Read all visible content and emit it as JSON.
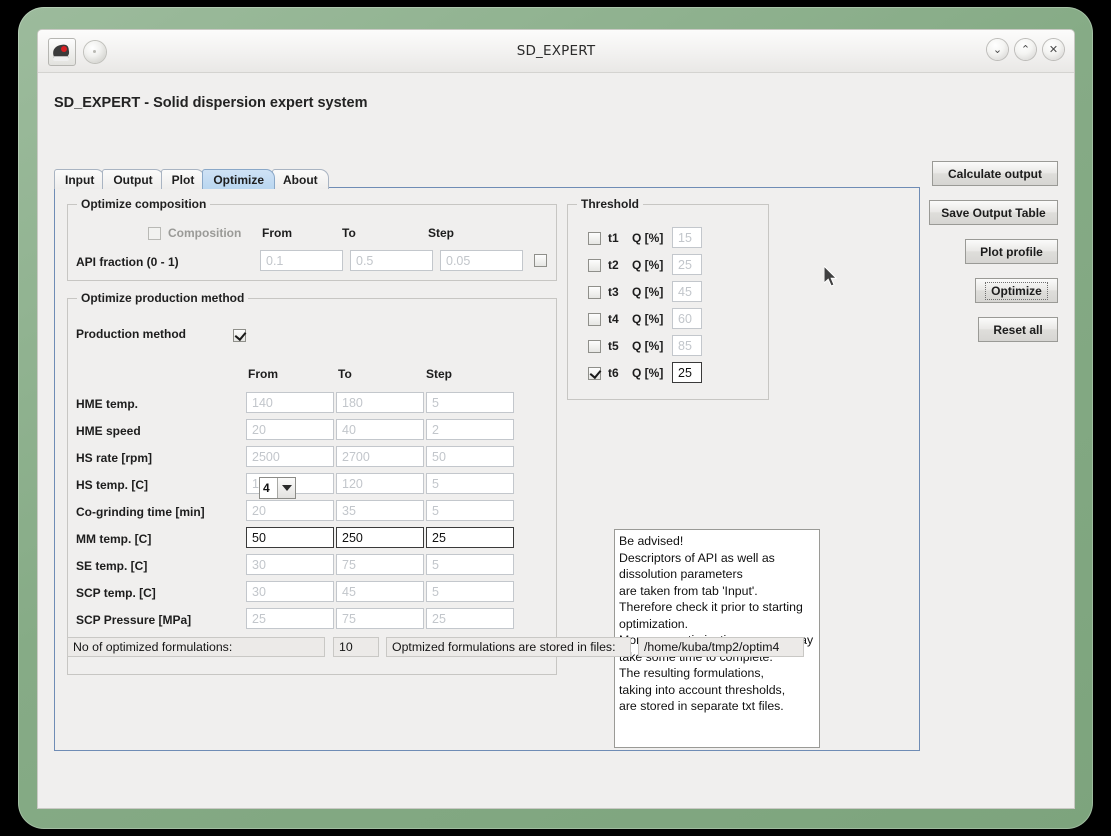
{
  "window": {
    "title": "SD_EXPERT",
    "app_icon": "java-duke-icon",
    "secondary_icon": "coffee-bean-icon",
    "controls": [
      {
        "name": "minimize-button",
        "glyph": "⌄"
      },
      {
        "name": "maximize-button",
        "glyph": "⌃"
      },
      {
        "name": "close-button",
        "glyph": "✕"
      }
    ]
  },
  "heading": "SD_EXPERT - Solid dispersion expert system",
  "tabs": [
    {
      "label": "Input",
      "active": false
    },
    {
      "label": "Output",
      "active": false
    },
    {
      "label": "Plot",
      "active": false
    },
    {
      "label": "Optimize",
      "active": true
    },
    {
      "label": "About",
      "active": false
    }
  ],
  "composition": {
    "group_title": "Optimize composition",
    "checkbox_label": "Composition",
    "checkbox_checked": false,
    "columns": [
      "From",
      "To",
      "Step"
    ],
    "row_label": "API fraction (0 - 1)",
    "from": "0.1",
    "to": "0.5",
    "step": "0.05",
    "row_checkbox_checked": false
  },
  "production": {
    "group_title": "Optimize production method",
    "method_label": "Production method",
    "method_value": "4",
    "method_checkbox_checked": true,
    "columns": [
      "From",
      "To",
      "Step"
    ],
    "rows": [
      {
        "label": "HME temp.",
        "from": "140",
        "to": "180",
        "step": "5",
        "enabled": false
      },
      {
        "label": "HME speed",
        "from": "20",
        "to": "40",
        "step": "2",
        "enabled": false
      },
      {
        "label": "HS rate [rpm]",
        "from": "2500",
        "to": "2700",
        "step": "50",
        "enabled": false
      },
      {
        "label": "HS temp. [C]",
        "from": "100",
        "to": "120",
        "step": "5",
        "enabled": false
      },
      {
        "label": "Co-grinding time [min]",
        "from": "20",
        "to": "35",
        "step": "5",
        "enabled": false
      },
      {
        "label": "MM temp. [C]",
        "from": "50",
        "to": "250",
        "step": "25",
        "enabled": true
      },
      {
        "label": "SE temp. [C]",
        "from": "30",
        "to": "75",
        "step": "5",
        "enabled": false
      },
      {
        "label": "SCP temp. [C]",
        "from": "30",
        "to": "45",
        "step": "5",
        "enabled": false
      },
      {
        "label": "SCP Pressure [MPa]",
        "from": "25",
        "to": "75",
        "step": "25",
        "enabled": false
      }
    ]
  },
  "threshold": {
    "group_title": "Threshold",
    "unit_label": "Q [%]",
    "rows": [
      {
        "label": "t1",
        "value": "15",
        "checked": false
      },
      {
        "label": "t2",
        "value": "25",
        "checked": false
      },
      {
        "label": "t3",
        "value": "45",
        "checked": false
      },
      {
        "label": "t4",
        "value": "60",
        "checked": false
      },
      {
        "label": "t5",
        "value": "85",
        "checked": false
      },
      {
        "label": "t6",
        "value": "25",
        "checked": true
      }
    ]
  },
  "advisory": {
    "text": "Be advised!\nDescriptors of API as well as\ndissolution parameters\nare taken from tab 'Input'.\nTherefore check it prior to starting\noptimization.\nMoreover optimization process may\ntake some time to complete.\nThe resulting formulations,\ntaking into account thresholds,\nare stored in separate txt files."
  },
  "status": {
    "count_label": "No of optimized formulations:",
    "count_value": "10",
    "files_label": "Optmized formulations are stored in files:",
    "files_value": "/home/kuba/tmp2/optim4"
  },
  "side_buttons": [
    {
      "label": "Calculate output",
      "focused": false
    },
    {
      "label": "Save Output Table",
      "focused": false
    },
    {
      "label": "Plot profile",
      "focused": false
    },
    {
      "label": "Optimize",
      "focused": true
    },
    {
      "label": "Reset all",
      "focused": false
    }
  ],
  "colors": {
    "desktop_frame": "#86ab86",
    "window_bg": "#f0efee",
    "panel_border": "#6f8cb5",
    "active_tab": "#bfd9f2",
    "disabled_text": "#c2c6cb",
    "enabled_text": "#111111"
  }
}
